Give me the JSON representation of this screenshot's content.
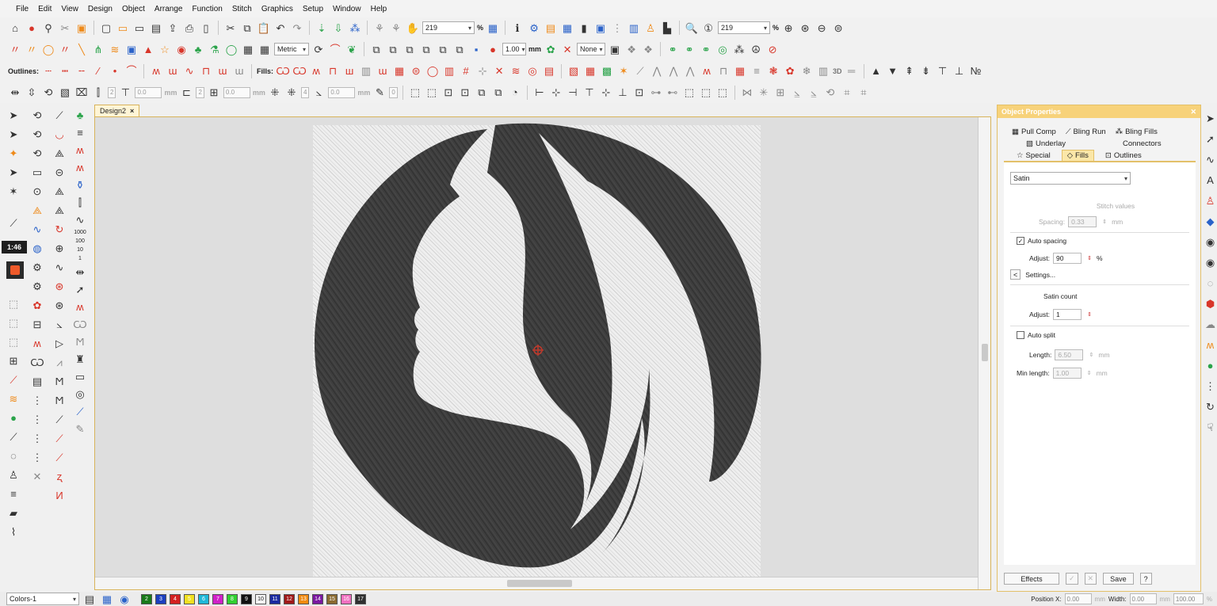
{
  "menu": [
    "File",
    "Edit",
    "View",
    "Design",
    "Object",
    "Arrange",
    "Function",
    "Stitch",
    "Graphics",
    "Setup",
    "Window",
    "Help"
  ],
  "toolbar1": {
    "zoom_value_1": "219",
    "zoom_pct_1": "%",
    "zoom_value_2": "219",
    "zoom_pct_2": "%"
  },
  "toolbar2": {
    "units": "Metric",
    "line_value": "1.00",
    "line_unit": "mm",
    "fill_none": "None"
  },
  "toolbar3": {
    "outlines_label": "Outlines:",
    "fills_label": "Fills:",
    "badge_3d": "3D"
  },
  "toolbar4": {
    "v1": "0.0",
    "v2": "2",
    "v3": "0.0",
    "u1": "mm",
    "v4": "2",
    "v5": "0.0",
    "u2": "mm",
    "v6": "4",
    "v7": "0.0",
    "u3": "mm",
    "v8": "0"
  },
  "left_palette": {
    "time_badge": "1:46",
    "num_1000": "1000",
    "num_100": "100",
    "num_10": "10",
    "num_1": "1"
  },
  "document": {
    "tab_label": "Design2",
    "close": "×"
  },
  "props": {
    "title": "Object Properties",
    "tabs_row1": [
      "Pull Comp",
      "Bling Run",
      "Bling Fills"
    ],
    "tabs_row2": [
      "Underlay",
      "Connectors"
    ],
    "tabs_row3": [
      "Special",
      "Fills",
      "Outlines"
    ],
    "active_tab": "Fills",
    "fill_type": "Satin",
    "stitch_values_header": "Stitch values",
    "spacing_label": "Spacing:",
    "spacing_value": "0.33",
    "spacing_unit": "mm",
    "auto_spacing_label": "Auto spacing",
    "auto_spacing_checked": true,
    "adjust_label": "Adjust:",
    "adjust_value": "90",
    "adjust_unit": "%",
    "settings_btn": "<",
    "settings_label": "Settings...",
    "satin_count_header": "Satin count",
    "adjust2_label": "Adjust:",
    "adjust2_value": "1",
    "auto_split_label": "Auto split",
    "auto_split_checked": false,
    "length_label": "Length:",
    "length_value": "6.50",
    "length_unit": "mm",
    "min_length_label": "Min length:",
    "min_length_value": "1.00",
    "min_length_unit": "mm",
    "effects_btn": "Effects",
    "save_btn": "Save",
    "help_btn": "?"
  },
  "status": {
    "position_label": "Position X:",
    "pos_x": "0.00",
    "pos_unit": "mm",
    "width_label": "Width:",
    "width_value": "0.00",
    "width_unit": "mm",
    "scale_value": "100.00",
    "scale_unit": "%",
    "swatch_numbers": [
      "2",
      "3",
      "4",
      "5",
      "6",
      "7",
      "8",
      "9",
      "10",
      "11",
      "12",
      "13",
      "14",
      "15",
      "16",
      "17"
    ],
    "swatch_colors": [
      "#1a7a1a",
      "#1c3fbf",
      "#d32020",
      "#f0e020",
      "#1fb8d8",
      "#d020c8",
      "#30d030",
      "#111111",
      "#f4f4f4",
      "#1a2aa0",
      "#a01818",
      "#f08a10",
      "#7a18a0",
      "#8a6a30",
      "#f070c0",
      "#303030"
    ],
    "trailing_labels": [
      "Colors-1"
    ]
  },
  "colors": {
    "accent": "#e3c06a",
    "embroidery_dark": "#3a3a3a",
    "embroidery_light": "#ececec"
  }
}
